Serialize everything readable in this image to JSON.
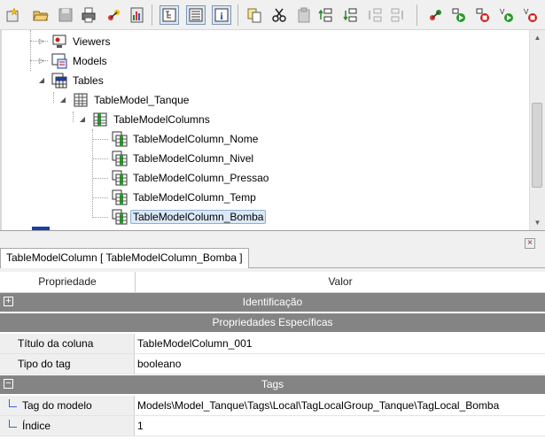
{
  "toolbar": {
    "buttons": [
      {
        "icon": "new-project-icon"
      },
      {
        "icon": "open-folder-icon"
      },
      {
        "icon": "save-icon"
      },
      {
        "icon": "print-icon"
      },
      {
        "icon": "deploy-icon"
      },
      {
        "icon": "chart-icon"
      },
      {
        "icon": "tree-view-icon",
        "pressed": true
      },
      {
        "icon": "list-view-icon",
        "pressed": true
      },
      {
        "icon": "info-icon",
        "pressed": true
      },
      {
        "icon": "copy-icon"
      },
      {
        "icon": "cut-icon"
      },
      {
        "icon": "paste-icon"
      },
      {
        "icon": "move-up-icon"
      },
      {
        "icon": "move-down-icon"
      },
      {
        "icon": "indent-icon"
      },
      {
        "icon": "outdent-icon"
      },
      {
        "icon": "connect-icon"
      },
      {
        "icon": "run-icon"
      },
      {
        "icon": "stop-icon"
      },
      {
        "icon": "run-variable-icon"
      },
      {
        "icon": "stop-variable-icon"
      }
    ]
  },
  "tree": {
    "items": [
      {
        "label": "Viewers",
        "icon": "viewers-icon"
      },
      {
        "label": "Models",
        "icon": "models-icon"
      },
      {
        "label": "Tables",
        "icon": "tables-icon"
      },
      {
        "label": "TableModel_Tanque",
        "icon": "table-model-icon"
      },
      {
        "label": "TableModelColumns",
        "icon": "columns-folder-icon"
      },
      {
        "label": "TableModelColumn_Nome",
        "icon": "column-icon"
      },
      {
        "label": "TableModelColumn_Nivel",
        "icon": "column-icon"
      },
      {
        "label": "TableModelColumn_Pressao",
        "icon": "column-icon"
      },
      {
        "label": "TableModelColumn_Temp",
        "icon": "column-icon"
      },
      {
        "label": "TableModelColumn_Bomba",
        "icon": "column-icon",
        "selected": true
      }
    ]
  },
  "tab": {
    "label": "TableModelColumn [ TableModelColumn_Bomba ]"
  },
  "grid": {
    "header_property": "Propriedade",
    "header_value": "Valor",
    "cat_identificacao": "Identificação",
    "cat_especificas": "Propriedades Específicas",
    "cat_tags": "Tags",
    "titulo_key": "Título da coluna",
    "titulo_value": "TableModelColumn_001",
    "tipo_key": "Tipo do tag",
    "tipo_value": "booleano",
    "tag_modelo_key": "Tag do modelo",
    "tag_modelo_value": "Models\\Model_Tanque\\Tags\\Local\\TagLocalGroup_Tanque\\TagLocal_Bomba",
    "indice_key": "Índice",
    "indice_value": "1"
  }
}
